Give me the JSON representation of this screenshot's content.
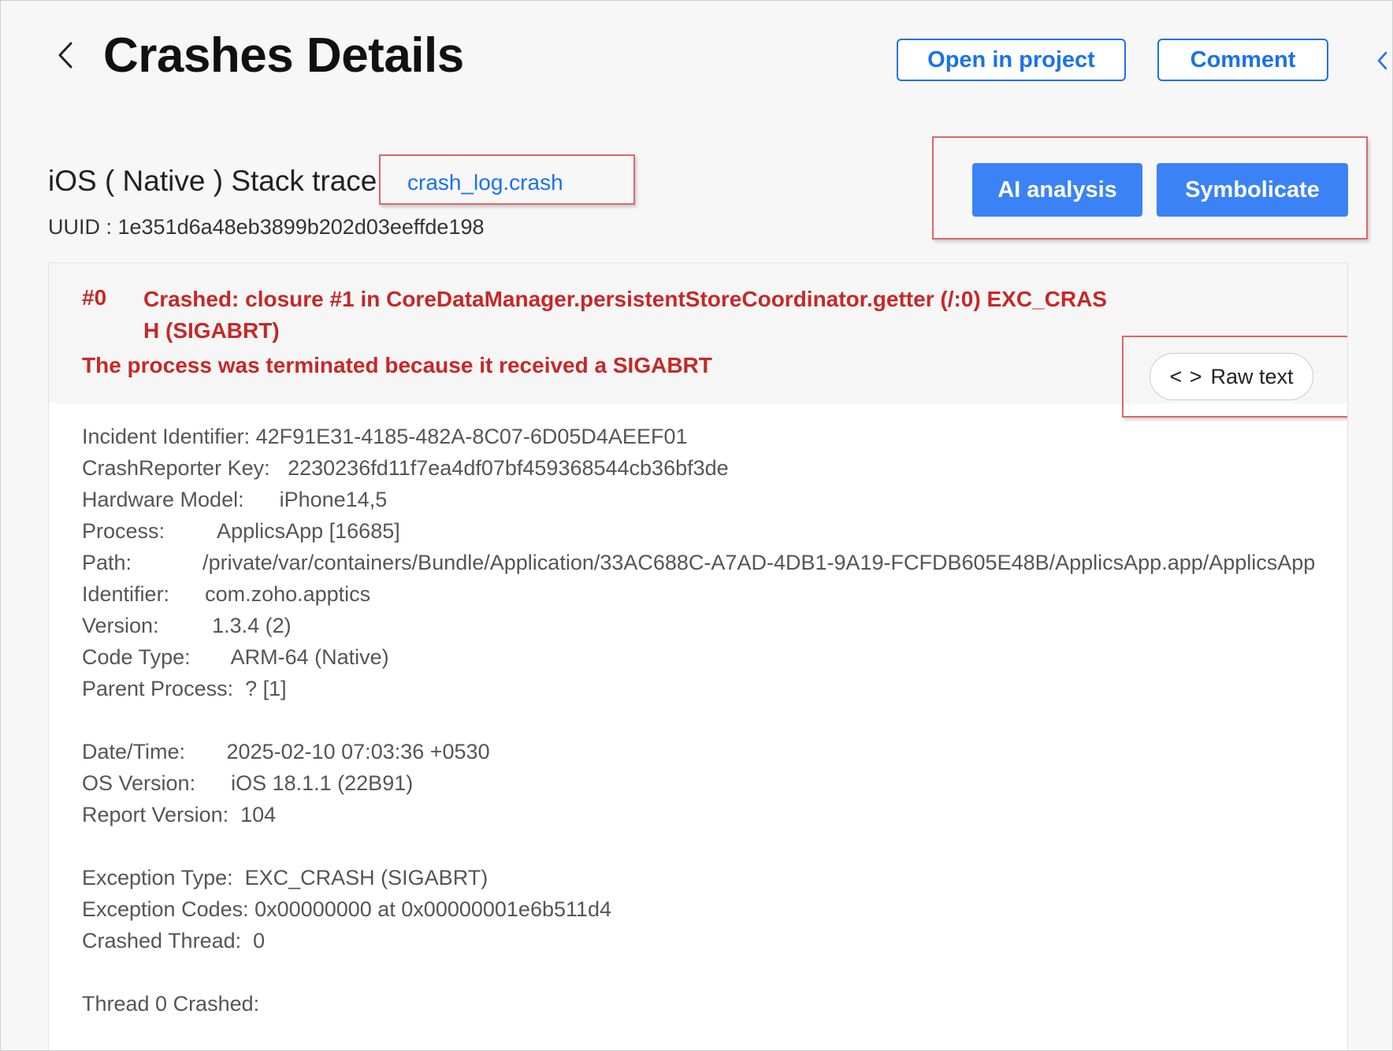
{
  "header": {
    "title": "Crashes Details",
    "open_in_project_label": "Open in project",
    "comment_label": "Comment"
  },
  "stack": {
    "title": "iOS ( Native ) Stack trace",
    "file_link": "crash_log.crash",
    "uuid": "UUID : 1e351d6a48eb3899b202d03eeffde198",
    "ai_analysis_label": "AI analysis",
    "symbolicate_label": "Symbolicate"
  },
  "crash": {
    "frame_index": "#0",
    "title": "Crashed: closure #1 in CoreDataManager.persistentStoreCoordinator.getter (/:0) EXC_CRASH (SIGABRT)",
    "reason": "The process was terminated because it received a SIGABRT",
    "raw_text_code": "< >",
    "raw_text_label": "Raw text"
  },
  "log": {
    "lines": [
      "Incident Identifier: 42F91E31-4185-482A-8C07-6D05D4AEEF01",
      "CrashReporter Key:   2230236fd11f7ea4df07bf459368544cb36bf3de",
      "Hardware Model:      iPhone14,5",
      "Process:         ApplicsApp [16685]",
      "Path:            /private/var/containers/Bundle/Application/33AC688C-A7AD-4DB1-9A19-FCFDB605E48B/ApplicsApp.app/ApplicsApp",
      "Identifier:      com.zoho.apptics",
      "Version:         1.3.4 (2)",
      "Code Type:       ARM-64 (Native)",
      "Parent Process:  ? [1]",
      "",
      "Date/Time:       2025-02-10 07:03:36 +0530",
      "OS Version:      iOS 18.1.1 (22B91)",
      "Report Version:  104",
      "",
      "Exception Type:  EXC_CRASH (SIGABRT)",
      "Exception Codes: 0x00000000 at 0x00000001e6b511d4",
      "Crashed Thread:  0",
      "",
      "Thread 0 Crashed:"
    ]
  },
  "colors": {
    "accent": "#1a73e8",
    "button_fill": "#3b82f6",
    "error": "#c62828",
    "annotation": "#e06666"
  },
  "icons": {
    "back": "chevron-left-icon",
    "edge": "chevron-left-icon",
    "raw": "code-icon"
  }
}
